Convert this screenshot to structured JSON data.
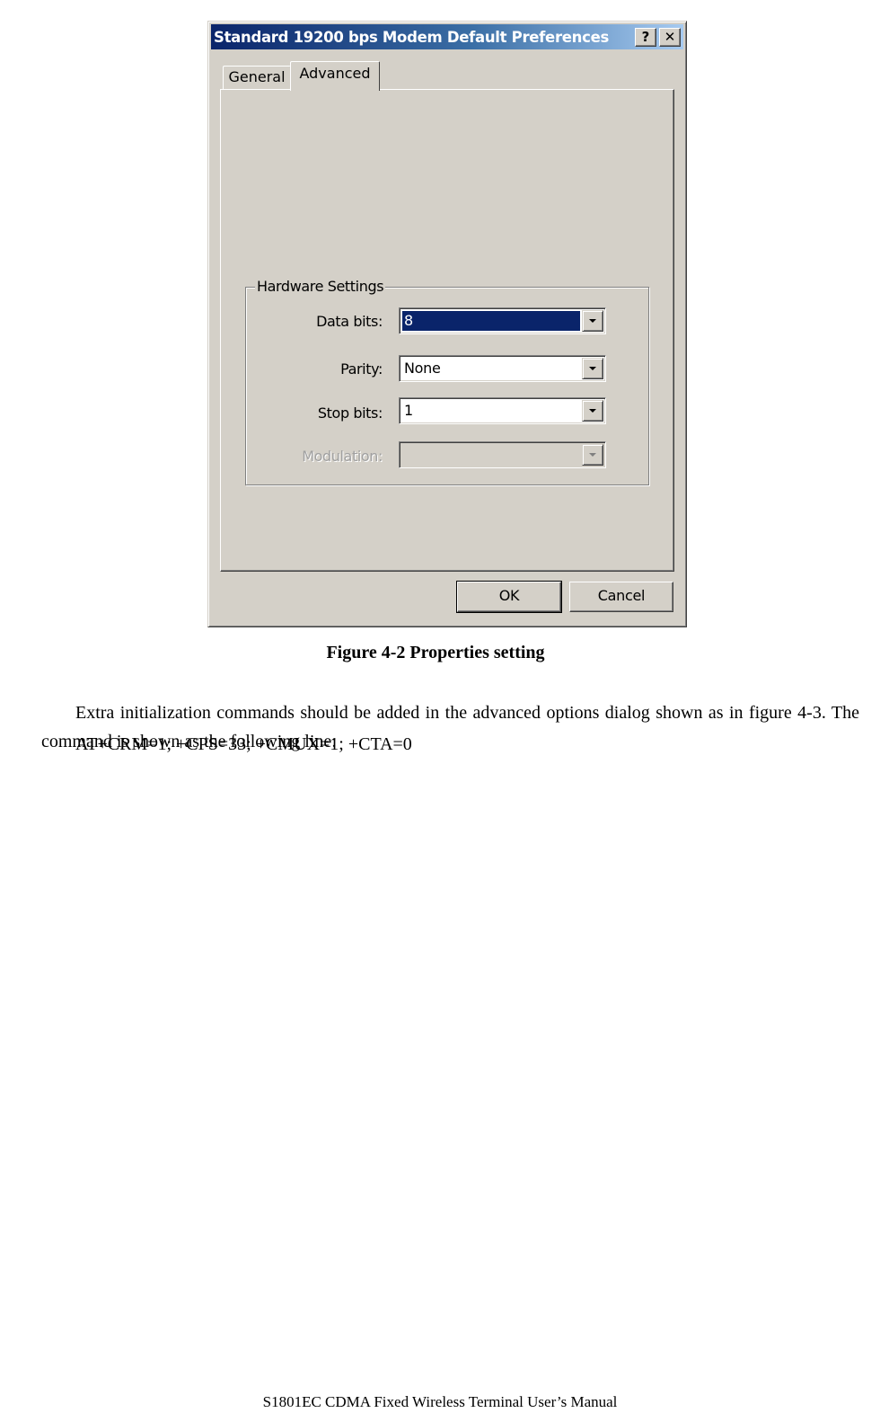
{
  "dialog": {
    "title": "Standard 19200 bps Modem Default Preferences",
    "help_button": "?",
    "close_button": "✕",
    "tabs": [
      {
        "label": "General",
        "active": false
      },
      {
        "label": "Advanced",
        "active": true
      }
    ],
    "groupbox_title": "Hardware Settings",
    "fields": [
      {
        "label": "Data bits:",
        "value": "8",
        "selected": true,
        "disabled": false
      },
      {
        "label": "Parity:",
        "value": "None",
        "selected": false,
        "disabled": false
      },
      {
        "label": "Stop bits:",
        "value": "1",
        "selected": false,
        "disabled": false
      },
      {
        "label": "Modulation:",
        "value": "",
        "selected": false,
        "disabled": true
      }
    ],
    "ok_label": "OK",
    "cancel_label": "Cancel",
    "colors": {
      "face": "#d4d0c8",
      "title_start": "#0a246a",
      "title_end": "#a6caf0",
      "selection": "#0a246a"
    }
  },
  "document": {
    "caption": "Figure 4-2 Properties setting",
    "paragraph": "Extra initialization commands should be added in the advanced options dialog shown as in figure 4-3. The command is shown as the following line:",
    "command": "AT+CRM=1; +CPS=33; +CMUX=1; +CTA=0",
    "footer": "S1801EC CDMA Fixed Wireless Terminal User’s Manual"
  }
}
